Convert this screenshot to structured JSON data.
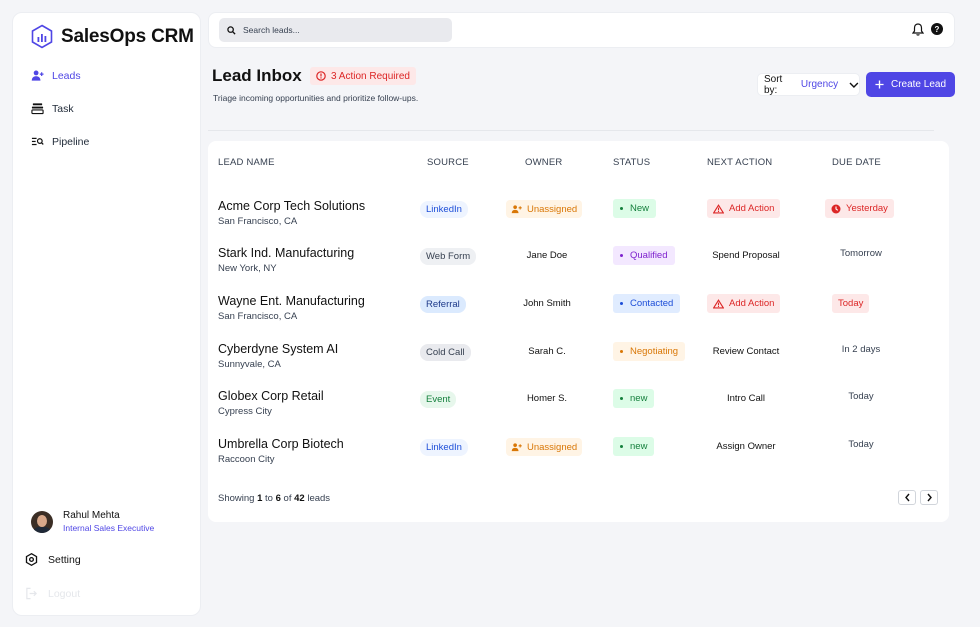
{
  "app": {
    "name": "SalesOps CRM"
  },
  "sidebar": {
    "items": [
      {
        "label": "Leads",
        "icon": "user-plus-icon",
        "active": true
      },
      {
        "label": "Task",
        "icon": "stack-icon"
      },
      {
        "label": "Pipeline",
        "icon": "list-search-icon"
      }
    ],
    "profile": {
      "name": "Rahul Mehta",
      "role": "Internal Sales Executive"
    },
    "setting_label": "Setting",
    "logout_label": "Logout"
  },
  "topbar": {
    "search_placeholder": "Search leads..."
  },
  "header": {
    "title": "Lead Inbox",
    "alert": "3 Action Required",
    "subtitle": "Triage incoming opportunities and prioritize follow-ups.",
    "sort_label": "Sort by:",
    "sort_value": "Urgency",
    "create_label": "Create Lead"
  },
  "table": {
    "columns": [
      "LEAD NAME",
      "SOURCE",
      "OWNER",
      "STATUS",
      "NEXT ACTION",
      "DUE DATE"
    ],
    "rows": [
      {
        "name": "Acme Corp Tech Solutions",
        "city": "San Francisco, CA",
        "source": "LinkedIn",
        "owner": "Unassigned",
        "status": "New",
        "action": "Add Action",
        "due": "Yesterday"
      },
      {
        "name": "Stark Ind. Manufacturing",
        "city": "New York, NY",
        "source": "Web Form",
        "owner": "Jane Doe",
        "status": "Qualified",
        "action": "Spend Proposal",
        "due": "Tomorrow"
      },
      {
        "name": "Wayne Ent. Manufacturing",
        "city": "San Francisco, CA",
        "source": "Referral",
        "owner": "John Smith",
        "status": "Contacted",
        "action": "Add Action",
        "due": "Today"
      },
      {
        "name": "Cyberdyne System AI",
        "city": "Sunnyvale, CA",
        "source": "Cold Call",
        "owner": "Sarah C.",
        "status": "Negotiating",
        "action": "Review Contact",
        "due": "In 2 days"
      },
      {
        "name": "Globex Corp Retail",
        "city": "Cypress City",
        "source": "Event",
        "owner": "Homer S.",
        "status": "new",
        "action": "Intro Call",
        "due": "Today"
      },
      {
        "name": "Umbrella Corp Biotech",
        "city": "Raccoon City",
        "source": "LinkedIn",
        "owner": "Unassigned",
        "status": "new",
        "action": "Assign Owner",
        "due": "Today"
      }
    ],
    "footer": {
      "prefix": "Showing",
      "from": "1",
      "to_word": "to",
      "to": "6",
      "of_word": "of",
      "total": "42",
      "suffix": "leads"
    }
  },
  "colors": {
    "accent": "#4f46e5",
    "danger": "#dc2626",
    "warning": "#d97706",
    "success": "#15803d"
  }
}
